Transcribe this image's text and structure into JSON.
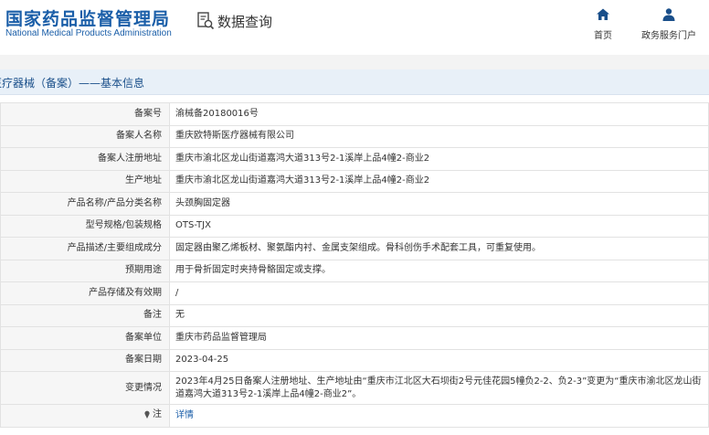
{
  "header": {
    "logo_cn": "国家药品监督管理局",
    "logo_en": "National Medical Products Administration",
    "query_label": "数据查询",
    "nav": [
      {
        "label": "首页",
        "icon": "home-icon"
      },
      {
        "label": "政务服务门户",
        "icon": "user-icon"
      }
    ],
    "brand_color": "#1a5ea8"
  },
  "section": {
    "title": "医疗器械（备案）——基本信息"
  },
  "rows": [
    {
      "label": "备案号",
      "value": "渝械备20180016号"
    },
    {
      "label": "备案人名称",
      "value": "重庆欧特斯医疗器械有限公司"
    },
    {
      "label": "备案人注册地址",
      "value": "重庆市渝北区龙山街道嘉鸿大道313号2-1溪岸上品4幢2-商业2"
    },
    {
      "label": "生产地址",
      "value": "重庆市渝北区龙山街道嘉鸿大道313号2-1溪岸上品4幢2-商业2"
    },
    {
      "label": "产品名称/产品分类名称",
      "value": "头颈胸固定器"
    },
    {
      "label": "型号规格/包装规格",
      "value": "OTS-TJX"
    },
    {
      "label": "产品描述/主要组成成分",
      "value": "固定器由聚乙烯板材、聚氨酯内衬、金属支架组成。骨科创伤手术配套工具，可重复使用。"
    },
    {
      "label": "预期用途",
      "value": "用于骨折固定时夹持骨骼固定或支撑。"
    },
    {
      "label": "产品存储及有效期",
      "value": "/"
    },
    {
      "label": "备注",
      "value": "无"
    },
    {
      "label": "备案单位",
      "value": "重庆市药品监督管理局"
    },
    {
      "label": "备案日期",
      "value": "2023-04-25"
    },
    {
      "label": "变更情况",
      "value": "2023年4月25日备案人注册地址、生产地址由“重庆市江北区大石坝街2号元佳花园5幢负2-2、负2-3”变更为“重庆市渝北区龙山街道嘉鸿大道313号2-1溪岸上品4幢2-商业2”。"
    },
    {
      "label": "注",
      "value": "详情"
    }
  ]
}
